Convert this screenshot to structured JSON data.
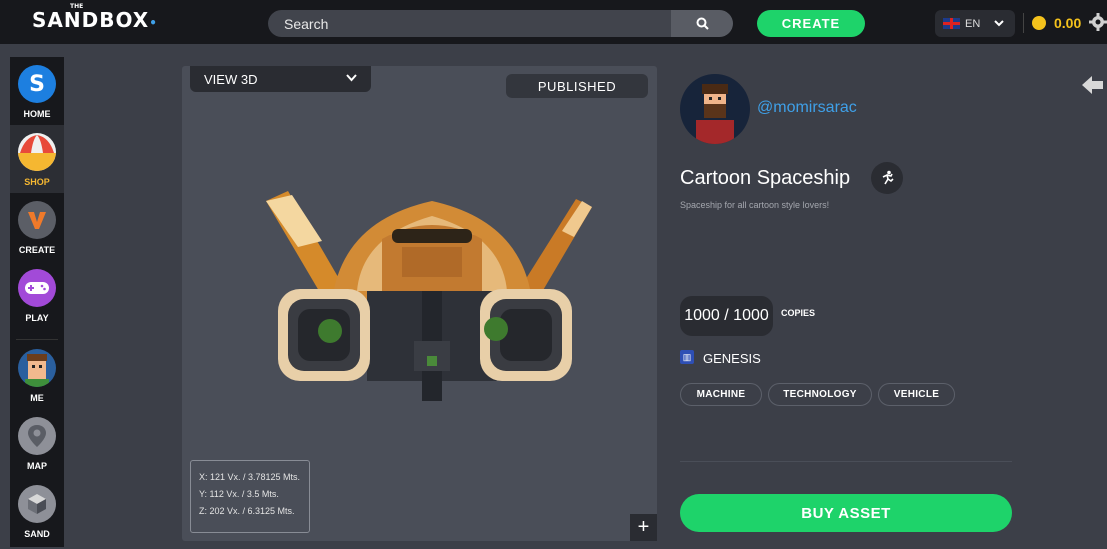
{
  "app": {
    "logo": "SANDBOX",
    "logo_super": "THE",
    "logo_dot": "•"
  },
  "topbar": {
    "search_text": "Search",
    "create_label": "CREATE",
    "language": "EN",
    "balance": "0.00"
  },
  "sidebar": {
    "items": [
      {
        "label": "HOME",
        "icon": "sandbox-s-icon"
      },
      {
        "label": "SHOP",
        "icon": "shop-awning-icon"
      },
      {
        "label": "CREATE",
        "icon": "create-v-icon"
      },
      {
        "label": "PLAY",
        "icon": "gamepad-icon"
      },
      {
        "label": "ME",
        "icon": "avatar-icon"
      },
      {
        "label": "MAP",
        "icon": "map-pin-icon"
      },
      {
        "label": "SAND",
        "icon": "sand-cube-icon"
      }
    ],
    "active": "SHOP"
  },
  "viewer": {
    "view_mode": "VIEW 3D",
    "status": "PUBLISHED",
    "dims": {
      "x": "X: 121 Vx. / 3.78125 Mts.",
      "y": "Y: 112 Vx. / 3.5 Mts.",
      "z": "Z: 202 Vx. / 6.3125 Mts."
    },
    "zoom_label": "+"
  },
  "asset": {
    "creator": "@momirsarac",
    "title": "Cartoon Spaceship",
    "description": "Spaceship for all cartoon style lovers!",
    "copies": "1000 / 1000",
    "copies_label": "COPIES",
    "collection": "GENESIS",
    "tags": [
      "MACHINE",
      "TECHNOLOGY",
      "VEHICLE"
    ],
    "buy_label": "BUY ASSET"
  },
  "colors": {
    "accent_green": "#1ed36a",
    "link_blue": "#3fa0e8",
    "coin_yellow": "#f4c21c",
    "active_nav": "#f5b731"
  }
}
